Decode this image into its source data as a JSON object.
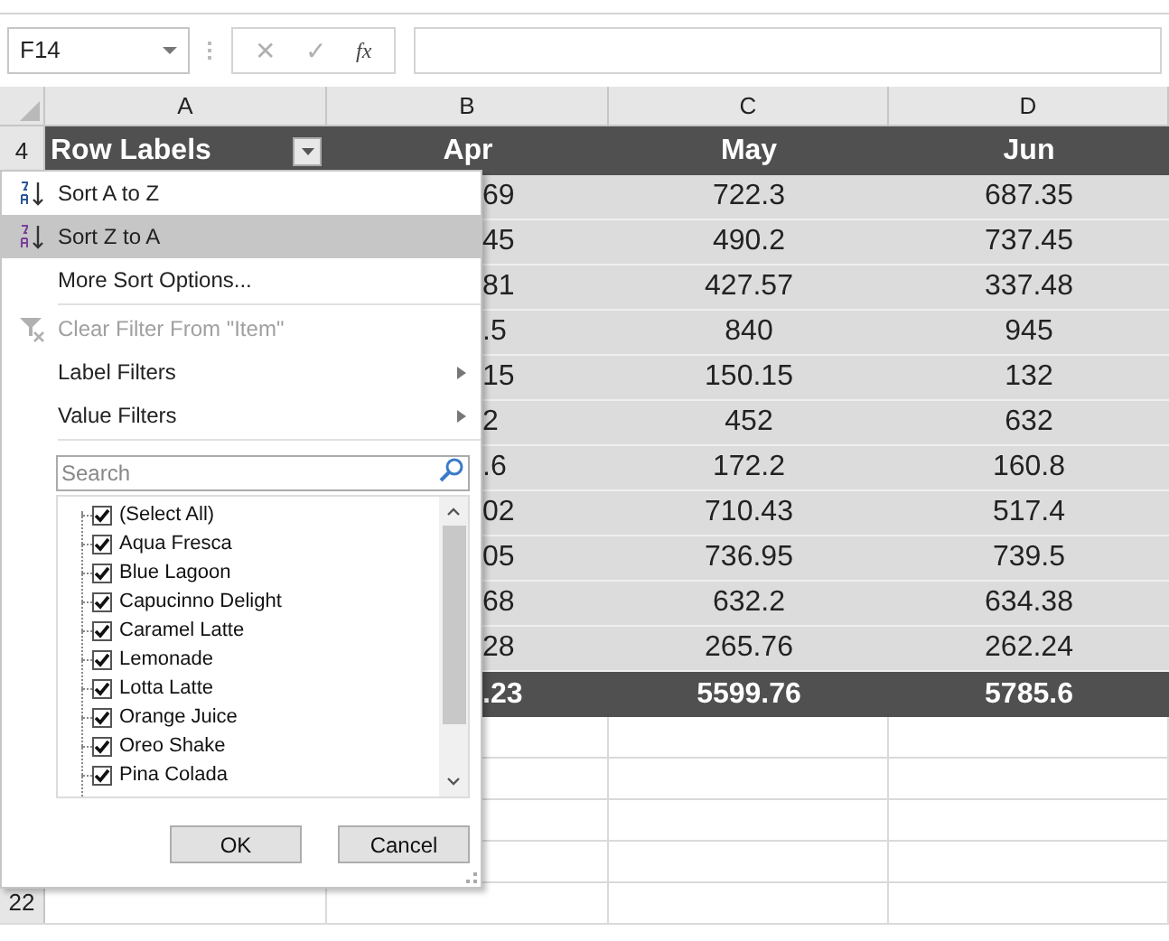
{
  "name_box": {
    "value": "F14"
  },
  "formula_bar": {
    "cancel": "✕",
    "enter": "✓",
    "function": "fx"
  },
  "column_headers": [
    "A",
    "B",
    "C",
    "D"
  ],
  "header_row": {
    "row_number": "4",
    "cells": [
      "Row Labels",
      "Apr",
      "May",
      "Jun"
    ]
  },
  "rows": [
    {
      "b": "69",
      "c": "722.3",
      "d": "687.35"
    },
    {
      "b": "45",
      "c": "490.2",
      "d": "737.45"
    },
    {
      "b": "81",
      "c": "427.57",
      "d": "337.48"
    },
    {
      "b": ".5",
      "c": "840",
      "d": "945"
    },
    {
      "b": "15",
      "c": "150.15",
      "d": "132"
    },
    {
      "b": "2",
      "c": "452",
      "d": "632"
    },
    {
      "b": ".6",
      "c": "172.2",
      "d": "160.8"
    },
    {
      "b": "02",
      "c": "710.43",
      "d": "517.4"
    },
    {
      "b": "05",
      "c": "736.95",
      "d": "739.5"
    },
    {
      "b": "68",
      "c": "632.2",
      "d": "634.38"
    },
    {
      "b": "28",
      "c": "265.76",
      "d": "262.24"
    }
  ],
  "total_row": {
    "b": ".23",
    "c": "5599.76",
    "d": "5785.6"
  },
  "last_row_number": "22",
  "filter_menu": {
    "items": [
      {
        "kind": "sort_az",
        "label": "Sort A to Z",
        "selected": false,
        "disabled": false
      },
      {
        "kind": "sort_za",
        "label": "Sort Z to A",
        "selected": true,
        "disabled": false
      },
      {
        "kind": "plain",
        "label": "More Sort Options...",
        "selected": false,
        "disabled": false
      },
      {
        "kind": "separator"
      },
      {
        "kind": "clear",
        "label": "Clear Filter From \"Item\"",
        "selected": false,
        "disabled": true
      },
      {
        "kind": "submenu",
        "label": "Label Filters",
        "selected": false,
        "disabled": false
      },
      {
        "kind": "submenu",
        "label": "Value Filters",
        "selected": false,
        "disabled": false
      },
      {
        "kind": "separator"
      }
    ],
    "search": {
      "placeholder": "Search"
    },
    "values": [
      {
        "label": "(Select All)",
        "checked": true
      },
      {
        "label": "Aqua Fresca",
        "checked": true
      },
      {
        "label": "Blue Lagoon",
        "checked": true
      },
      {
        "label": "Capucinno Delight",
        "checked": true
      },
      {
        "label": "Caramel Latte",
        "checked": true
      },
      {
        "label": "Lemonade",
        "checked": true
      },
      {
        "label": "Lotta Latte",
        "checked": true
      },
      {
        "label": "Orange Juice",
        "checked": true
      },
      {
        "label": "Oreo Shake",
        "checked": true
      },
      {
        "label": "Pina Colada",
        "checked": true
      }
    ],
    "buttons": [
      "OK",
      "Cancel"
    ]
  }
}
